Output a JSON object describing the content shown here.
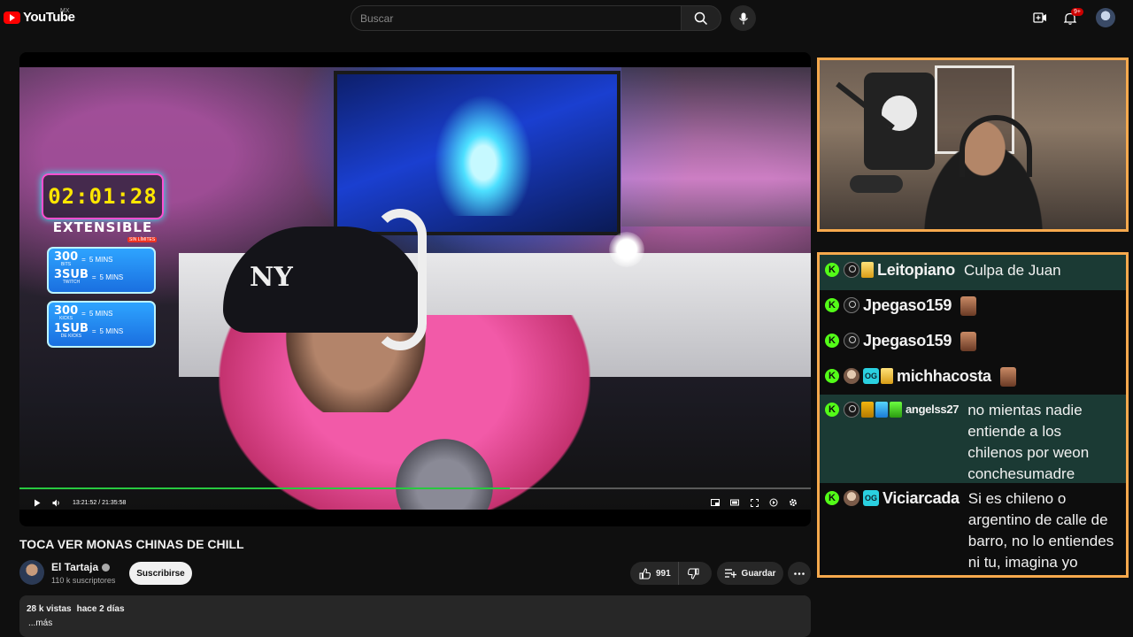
{
  "topbar": {
    "logo_text": "YouTube",
    "country": "MX",
    "search_placeholder": "Buscar",
    "notifications": "9+"
  },
  "player": {
    "time_current": "13:21:52",
    "time_separator": "/",
    "time_total": "21:35:58",
    "progress_fraction": 0.62,
    "overlay": {
      "timer": "02:01:28",
      "extensible": "EXTENSIBLE",
      "sin_limites": "SIN LÍMITES",
      "promo1": [
        {
          "big": "300",
          "small": "BITS",
          "value": "5 MINS"
        },
        {
          "big": "3SUB",
          "small": "TWITCH",
          "value": "5 MINS"
        }
      ],
      "promo2": [
        {
          "big": "300",
          "small": "KICKS",
          "value": "5 MINS"
        },
        {
          "big": "1SUB",
          "small": "DE KICKS",
          "value": "5 MINS"
        }
      ],
      "cap_logo": "NY"
    }
  },
  "video": {
    "title": "TOCA VER MONAS CHINAS DE CHILL",
    "channel_name": "El Tartaja",
    "subscribers": "110 k suscriptores",
    "subscribe_label": "Suscribirse",
    "likes": "991",
    "save_label": "Guardar",
    "views": "28 k vistas",
    "date": "hace 2 días",
    "more_label": "...más"
  },
  "chat": {
    "messages": [
      {
        "user": "Leitopiano",
        "text": "Culpa de Juan"
      },
      {
        "user": "Jpegaso159",
        "text": ""
      },
      {
        "user": "Jpegaso159",
        "text": ""
      },
      {
        "user": "michhacosta",
        "text": ""
      },
      {
        "user": "angelss27",
        "text": "no mientas nadie entiende a los chilenos por weon conchesumadre"
      },
      {
        "user": "Viciarcada",
        "text": "Si es chileno o argentino de calle de barro, no lo entiendes ni tu, imagina yo"
      }
    ],
    "kick_badge": "K",
    "og_badge": "OG"
  },
  "colors": {
    "accent": "#ff0000",
    "kick_green": "#53fc18",
    "frame_orange": "#f6a94d",
    "progress_green": "#28c840"
  }
}
